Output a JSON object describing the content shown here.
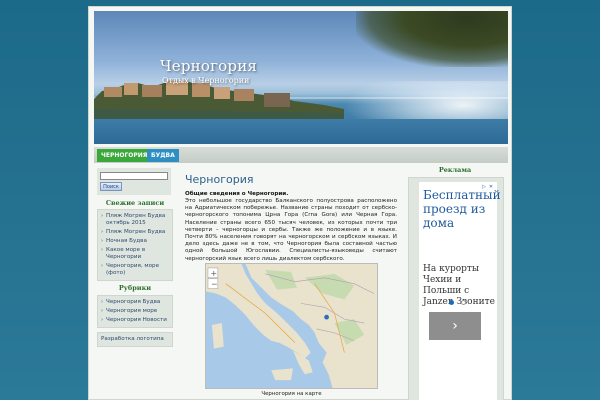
{
  "header": {
    "title": "Черногория",
    "tagline": "Отдых в Черногории"
  },
  "nav": {
    "items": [
      {
        "label": "Черногория",
        "color": "#3aa83a"
      },
      {
        "label": "Будва",
        "color": "#2e8fc4"
      }
    ]
  },
  "search": {
    "button_label": "Поиск",
    "value": ""
  },
  "sidebar": {
    "recent_title": "Свежие записи",
    "recent": [
      "Пляж Могрен Будва октябрь 2015",
      "Пляж Могрен Будва",
      "Ночная Будва",
      "Какое море в Черногории",
      "Черногория, море (фото)"
    ],
    "categories_title": "Рубрики",
    "categories": [
      "Черногория Будва",
      "Черногория море",
      "Черногория Новости"
    ],
    "extra_link": "Разработка логотипа"
  },
  "post": {
    "title": "Черногория",
    "subtitle": "Общие сведения о Черногории.",
    "body": "Это небольшое государство Балканского полуострова расположено на Адриатическом побережье. Название страны походит от сербско-черногорского топонима Црна Гора (Crna Gora) или Черная Гора. Население страны всего 650 тысяч человек, из которых почти три четверти – черногорцы и сербы. Также же положение и в языке. Почти 80% населения говорят на черногорском и сербском языках. И дело здесь даже не в том, что Черногория была составной частью одной большой Югославии. Специалисты-языковеды считают черногорский язык всего лишь диалектом сербского.",
    "map_caption": "Черногория на карте"
  },
  "right_sidebar": {
    "title": "Реклама",
    "ad": {
      "headline": "Бесплатный проезд из дома",
      "sub": "На курорты Чехии и Польши с Janzen Звоните",
      "next_label": "›"
    }
  },
  "colors": {
    "background": "#236f8e",
    "accent_green": "#2b6e2b",
    "link_blue": "#2d5f8b"
  }
}
